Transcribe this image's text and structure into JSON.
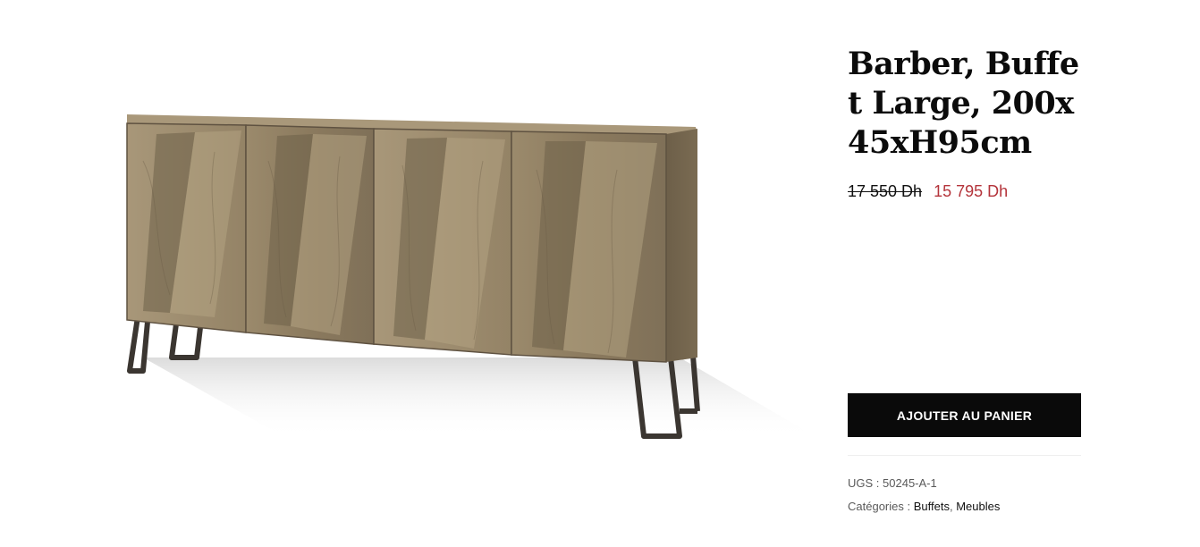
{
  "product": {
    "title": "Barber, Buffet Large, 200x45xH95cm",
    "price_regular": "17 550 Dh",
    "price_sale": "15 795 Dh",
    "add_to_cart_label": "AJOUTER AU PANIER",
    "sku_label": "UGS :",
    "sku_value": "50245-A-1",
    "categories_label": "Catégories :",
    "categories": [
      "Buffets",
      "Meubles"
    ],
    "category_separator": ","
  },
  "colors": {
    "sale_price": "#b4343b",
    "button_bg": "#0a0a0a",
    "button_text": "#ffffff"
  }
}
